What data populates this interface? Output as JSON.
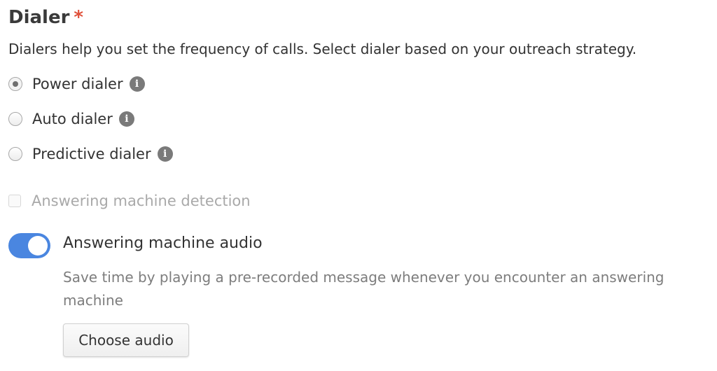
{
  "dialer": {
    "title": "Dialer",
    "required_marker": "*",
    "description": "Dialers help you set the frequency of calls. Select dialer based on your outreach strategy.",
    "options": [
      {
        "label": "Power dialer",
        "selected": true,
        "icon": "info-icon"
      },
      {
        "label": "Auto dialer",
        "selected": false,
        "icon": "info-icon"
      },
      {
        "label": "Predictive dialer",
        "selected": false,
        "icon": "info-icon"
      }
    ],
    "info_glyph": "i"
  },
  "answering_machine_detection": {
    "label": "Answering machine detection",
    "checked": false,
    "disabled": true
  },
  "answering_machine_audio": {
    "label": "Answering machine audio",
    "enabled": true,
    "description": "Save time by playing a pre-recorded message whenever you encounter an answering machine",
    "button_label": "Choose audio"
  },
  "colors": {
    "toggle_on": "#4a86e0",
    "required": "#e0513b",
    "muted_text": "#7d7d7d",
    "disabled_text": "#a9a9a9"
  }
}
